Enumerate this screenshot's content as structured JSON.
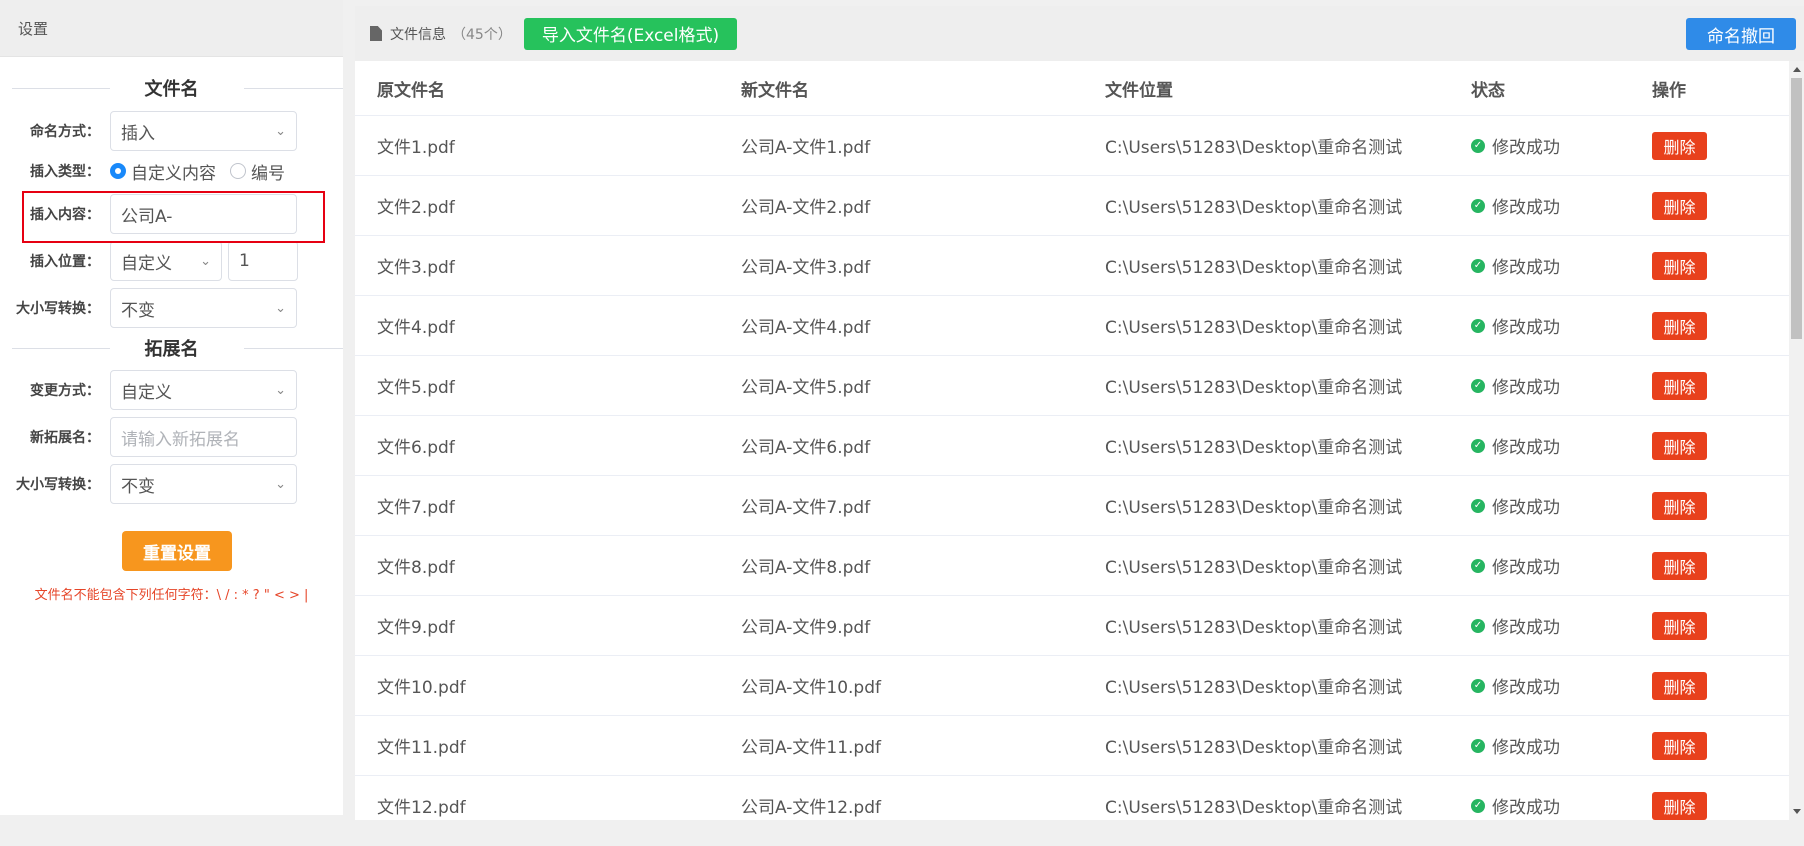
{
  "settings": {
    "header": "设置",
    "filename_section": "文件名",
    "naming_method": {
      "label": "命名方式：",
      "value": "插入"
    },
    "insert_type": {
      "label": "插入类型：",
      "options": [
        "自定义内容",
        "编号"
      ],
      "selected": "自定义内容"
    },
    "insert_content": {
      "label": "插入内容：",
      "value": "公司A-"
    },
    "insert_position": {
      "label": "插入位置：",
      "value": "自定义",
      "number": "1"
    },
    "case_convert": {
      "label": "大小写转换：",
      "value": "不变"
    },
    "extension_section": "拓展名",
    "change_method": {
      "label": "变更方式：",
      "value": "自定义"
    },
    "new_extension": {
      "label": "新拓展名：",
      "placeholder": "请输入新拓展名"
    },
    "ext_case_convert": {
      "label": "大小写转换：",
      "value": "不变"
    },
    "reset_button": "重置设置",
    "warning": "文件名不能包含下列任何字符：\\ / : * ? \" < > |"
  },
  "files": {
    "header_title": "文件信息",
    "header_count": "（45个）",
    "import_button": "导入文件名(Excel格式)",
    "undo_button": "命名撤回",
    "columns": [
      "原文件名",
      "新文件名",
      "文件位置",
      "状态",
      "操作"
    ],
    "rows": [
      {
        "original": "文件1.pdf",
        "new": "公司A-文件1.pdf",
        "location": "C:\\Users\\51283\\Desktop\\重命名测试",
        "status": "修改成功",
        "action": "删除"
      },
      {
        "original": "文件2.pdf",
        "new": "公司A-文件2.pdf",
        "location": "C:\\Users\\51283\\Desktop\\重命名测试",
        "status": "修改成功",
        "action": "删除"
      },
      {
        "original": "文件3.pdf",
        "new": "公司A-文件3.pdf",
        "location": "C:\\Users\\51283\\Desktop\\重命名测试",
        "status": "修改成功",
        "action": "删除"
      },
      {
        "original": "文件4.pdf",
        "new": "公司A-文件4.pdf",
        "location": "C:\\Users\\51283\\Desktop\\重命名测试",
        "status": "修改成功",
        "action": "删除"
      },
      {
        "original": "文件5.pdf",
        "new": "公司A-文件5.pdf",
        "location": "C:\\Users\\51283\\Desktop\\重命名测试",
        "status": "修改成功",
        "action": "删除"
      },
      {
        "original": "文件6.pdf",
        "new": "公司A-文件6.pdf",
        "location": "C:\\Users\\51283\\Desktop\\重命名测试",
        "status": "修改成功",
        "action": "删除"
      },
      {
        "original": "文件7.pdf",
        "new": "公司A-文件7.pdf",
        "location": "C:\\Users\\51283\\Desktop\\重命名测试",
        "status": "修改成功",
        "action": "删除"
      },
      {
        "original": "文件8.pdf",
        "new": "公司A-文件8.pdf",
        "location": "C:\\Users\\51283\\Desktop\\重命名测试",
        "status": "修改成功",
        "action": "删除"
      },
      {
        "original": "文件9.pdf",
        "new": "公司A-文件9.pdf",
        "location": "C:\\Users\\51283\\Desktop\\重命名测试",
        "status": "修改成功",
        "action": "删除"
      },
      {
        "original": "文件10.pdf",
        "new": "公司A-文件10.pdf",
        "location": "C:\\Users\\51283\\Desktop\\重命名测试",
        "status": "修改成功",
        "action": "删除"
      },
      {
        "original": "文件11.pdf",
        "new": "公司A-文件11.pdf",
        "location": "C:\\Users\\51283\\Desktop\\重命名测试",
        "status": "修改成功",
        "action": "删除"
      },
      {
        "original": "文件12.pdf",
        "new": "公司A-文件12.pdf",
        "location": "C:\\Users\\51283\\Desktop\\重命名测试",
        "status": "修改成功",
        "action": "删除"
      }
    ]
  },
  "colors": {
    "import_button": "#26c25c",
    "undo_button": "#2f8be8",
    "reset_button": "#f7961e",
    "delete_button": "#e8401c",
    "success_icon": "#26b561",
    "highlight_box": "#e60012"
  },
  "icons": {
    "file_info": "file-icon",
    "status": "check-circle-icon",
    "select": "chevron-down-icon"
  }
}
